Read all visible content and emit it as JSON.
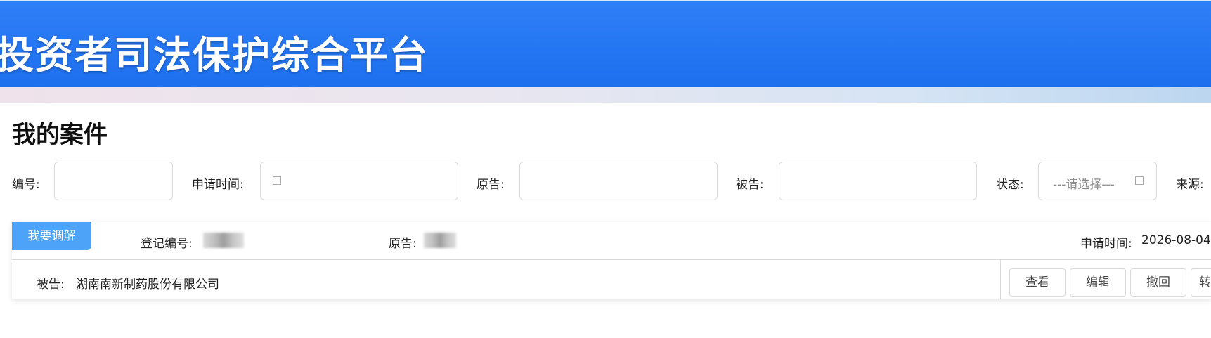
{
  "header": {
    "title": "投资者司法保护综合平台"
  },
  "page": {
    "title": "我的案件"
  },
  "filters": {
    "number_label": "编号:",
    "number_value": "",
    "apply_time_label": "申请时间:",
    "apply_time_value": "",
    "plaintiff_label": "原告:",
    "plaintiff_value": "",
    "defendant_label": "被告:",
    "defendant_value": "",
    "status_label": "状态:",
    "status_placeholder": "---请选择---",
    "source_label": "来源:"
  },
  "case_card": {
    "mediate_button": "我要调解",
    "register_no_label": "登记编号:",
    "plaintiff_label": "原告:",
    "apply_time_label": "申请时间:",
    "apply_time_value": "2026-08-04",
    "defendant_label": "被告:",
    "defendant_value": "湖南南新制药股份有限公司",
    "actions": [
      "查看",
      "编辑",
      "撤回",
      "转"
    ]
  },
  "colors": {
    "header_blue": "#2477f2",
    "mediate_button": "#4da3f7"
  }
}
